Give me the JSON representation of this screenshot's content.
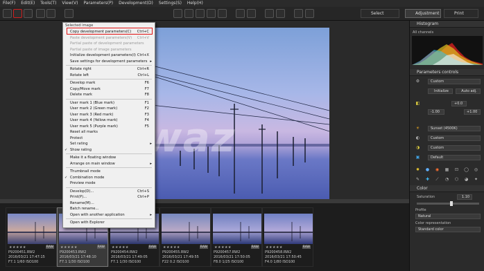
{
  "menubar": {
    "items": [
      "File(F)",
      "Edit(E)",
      "Tools(T)",
      "View(V)",
      "Parameters(P)",
      "Development(D)",
      "Settings(S)",
      "Help(H)"
    ]
  },
  "topright": {
    "select": "Select",
    "adjustment": "Adjustment",
    "print": "Print"
  },
  "context_menu": {
    "header": "Selected image",
    "items": [
      {
        "label": "Copy development parameters(C)",
        "shortcut": "Ctrl+C",
        "disabled": false,
        "highlight": true
      },
      {
        "label": "Paste development parameters(V)",
        "shortcut": "Ctrl+V",
        "disabled": true
      },
      {
        "label": "Partial paste of development parameters",
        "shortcut": "",
        "disabled": true
      },
      {
        "label": "Partial paste of image parameters",
        "shortcut": "",
        "disabled": true
      },
      {
        "label": "Initialize development parameters(I)",
        "shortcut": "Ctrl+X",
        "disabled": false
      },
      {
        "label": "Save settings for development parameters",
        "shortcut": "",
        "disabled": false,
        "arrow": true
      },
      {
        "label": "Rotate right",
        "shortcut": "Ctrl+R"
      },
      {
        "label": "Rotate left",
        "shortcut": "Ctrl+L"
      },
      {
        "label": "Develop mark",
        "shortcut": "F6"
      },
      {
        "label": "Copy/Move mark",
        "shortcut": "F7"
      },
      {
        "label": "Delete mark",
        "shortcut": "F8"
      },
      {
        "label": "User mark 1 (Blue mark)",
        "shortcut": "F1"
      },
      {
        "label": "User mark 2 (Green mark)",
        "shortcut": "F2"
      },
      {
        "label": "User mark 3 (Red mark)",
        "shortcut": "F3"
      },
      {
        "label": "User mark 4 (Yellow mark)",
        "shortcut": "F4"
      },
      {
        "label": "User mark 5 (Purple mark)",
        "shortcut": "F5"
      },
      {
        "label": "Reset all marks",
        "shortcut": ""
      },
      {
        "label": "Protect",
        "shortcut": ""
      },
      {
        "label": "Set rating",
        "shortcut": "",
        "arrow": true
      },
      {
        "label": "Show rating",
        "shortcut": "",
        "check": true
      },
      {
        "label": "Make it a floating window",
        "shortcut": ""
      },
      {
        "label": "Arrange on main window",
        "shortcut": "",
        "arrow": true
      },
      {
        "label": "Thumbnail mode",
        "shortcut": ""
      },
      {
        "label": "Combination mode",
        "shortcut": "",
        "check": true
      },
      {
        "label": "Preview mode",
        "shortcut": ""
      },
      {
        "label": "Develop(D)...",
        "shortcut": "Ctrl+S"
      },
      {
        "label": "Print(P)...",
        "shortcut": "Ctrl+P"
      },
      {
        "label": "Rename(M)...",
        "shortcut": ""
      },
      {
        "label": "Batch rename...",
        "shortcut": ""
      },
      {
        "label": "Open with another application",
        "shortcut": "",
        "arrow": true
      },
      {
        "label": "Open with Explorer",
        "shortcut": ""
      }
    ]
  },
  "watermark": "Aiwaz",
  "thumbnails": [
    {
      "name": "P9200451.RW2",
      "date": "2016/03/21 17:47:15",
      "info": "F7.1 1/60 ISO100",
      "stars": "★★★★★",
      "raw": "RAW"
    },
    {
      "name": "P9200453.RW2",
      "date": "2016/03/21 17:48:10",
      "info": "F7.1 1/30 ISO100",
      "stars": "★★★★★",
      "raw": "RAW"
    },
    {
      "name": "P9200454.RW2",
      "date": "2016/03/21 17:49:05",
      "info": "F7.1 1/30 ISO100",
      "stars": "★★★★★",
      "raw": "RAW"
    },
    {
      "name": "P9200455.RW2",
      "date": "2016/03/21 17:49:55",
      "info": "F22 0.2 ISO100",
      "stars": "★★★★★",
      "raw": "RAW"
    },
    {
      "name": "P9200457.RW2",
      "date": "2016/03/21 17:50:05",
      "info": "F8.0 1/25 ISO100",
      "stars": "★★★★★",
      "raw": "RAW"
    },
    {
      "name": "P9200458.RW2",
      "date": "2016/03/21 17:50:45",
      "info": "F4.0 1/80 ISO100",
      "stars": "★★★★★",
      "raw": "RAW"
    }
  ],
  "rpanel": {
    "histogram": "Histogram",
    "all_channels": "All channels",
    "basic_controls": "Parameters controls",
    "custom": "Custom",
    "initialize": "Initialize",
    "auto_adj": "Auto adj.",
    "ev": "+0.0",
    "left_val": "-1.00",
    "right_val": "+1.00",
    "sunset": "Sunset (4500K)",
    "custom2": "Custom",
    "custom3": "Custom",
    "default": "Default",
    "color": "Color",
    "saturation": "Saturation",
    "saturation_value": "1.10",
    "profile": "Profile",
    "natural": "Natural",
    "color_rep": "Color representation",
    "standard": "Standard color"
  }
}
